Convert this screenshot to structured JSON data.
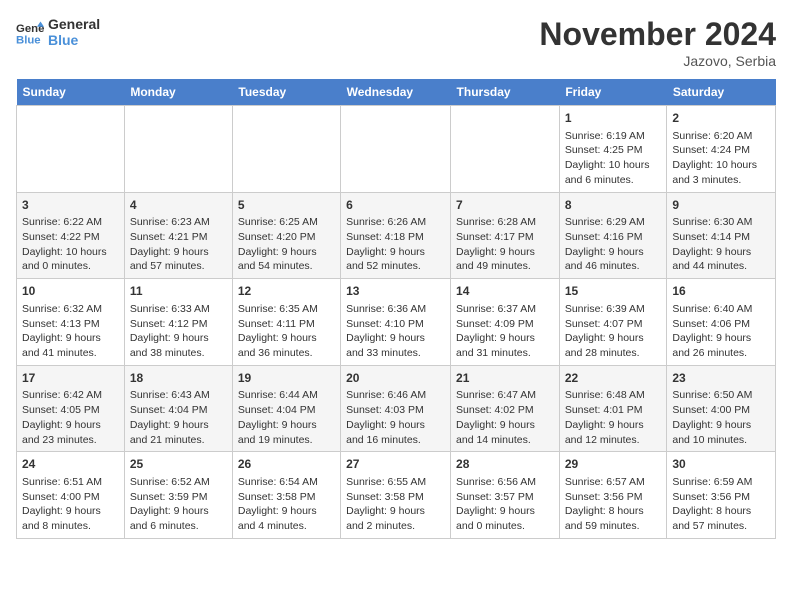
{
  "header": {
    "logo_line1": "General",
    "logo_line2": "Blue",
    "month": "November 2024",
    "location": "Jazovo, Serbia"
  },
  "weekdays": [
    "Sunday",
    "Monday",
    "Tuesday",
    "Wednesday",
    "Thursday",
    "Friday",
    "Saturday"
  ],
  "weeks": [
    [
      {
        "day": "",
        "text": ""
      },
      {
        "day": "",
        "text": ""
      },
      {
        "day": "",
        "text": ""
      },
      {
        "day": "",
        "text": ""
      },
      {
        "day": "",
        "text": ""
      },
      {
        "day": "1",
        "text": "Sunrise: 6:19 AM\nSunset: 4:25 PM\nDaylight: 10 hours and 6 minutes."
      },
      {
        "day": "2",
        "text": "Sunrise: 6:20 AM\nSunset: 4:24 PM\nDaylight: 10 hours and 3 minutes."
      }
    ],
    [
      {
        "day": "3",
        "text": "Sunrise: 6:22 AM\nSunset: 4:22 PM\nDaylight: 10 hours and 0 minutes."
      },
      {
        "day": "4",
        "text": "Sunrise: 6:23 AM\nSunset: 4:21 PM\nDaylight: 9 hours and 57 minutes."
      },
      {
        "day": "5",
        "text": "Sunrise: 6:25 AM\nSunset: 4:20 PM\nDaylight: 9 hours and 54 minutes."
      },
      {
        "day": "6",
        "text": "Sunrise: 6:26 AM\nSunset: 4:18 PM\nDaylight: 9 hours and 52 minutes."
      },
      {
        "day": "7",
        "text": "Sunrise: 6:28 AM\nSunset: 4:17 PM\nDaylight: 9 hours and 49 minutes."
      },
      {
        "day": "8",
        "text": "Sunrise: 6:29 AM\nSunset: 4:16 PM\nDaylight: 9 hours and 46 minutes."
      },
      {
        "day": "9",
        "text": "Sunrise: 6:30 AM\nSunset: 4:14 PM\nDaylight: 9 hours and 44 minutes."
      }
    ],
    [
      {
        "day": "10",
        "text": "Sunrise: 6:32 AM\nSunset: 4:13 PM\nDaylight: 9 hours and 41 minutes."
      },
      {
        "day": "11",
        "text": "Sunrise: 6:33 AM\nSunset: 4:12 PM\nDaylight: 9 hours and 38 minutes."
      },
      {
        "day": "12",
        "text": "Sunrise: 6:35 AM\nSunset: 4:11 PM\nDaylight: 9 hours and 36 minutes."
      },
      {
        "day": "13",
        "text": "Sunrise: 6:36 AM\nSunset: 4:10 PM\nDaylight: 9 hours and 33 minutes."
      },
      {
        "day": "14",
        "text": "Sunrise: 6:37 AM\nSunset: 4:09 PM\nDaylight: 9 hours and 31 minutes."
      },
      {
        "day": "15",
        "text": "Sunrise: 6:39 AM\nSunset: 4:07 PM\nDaylight: 9 hours and 28 minutes."
      },
      {
        "day": "16",
        "text": "Sunrise: 6:40 AM\nSunset: 4:06 PM\nDaylight: 9 hours and 26 minutes."
      }
    ],
    [
      {
        "day": "17",
        "text": "Sunrise: 6:42 AM\nSunset: 4:05 PM\nDaylight: 9 hours and 23 minutes."
      },
      {
        "day": "18",
        "text": "Sunrise: 6:43 AM\nSunset: 4:04 PM\nDaylight: 9 hours and 21 minutes."
      },
      {
        "day": "19",
        "text": "Sunrise: 6:44 AM\nSunset: 4:04 PM\nDaylight: 9 hours and 19 minutes."
      },
      {
        "day": "20",
        "text": "Sunrise: 6:46 AM\nSunset: 4:03 PM\nDaylight: 9 hours and 16 minutes."
      },
      {
        "day": "21",
        "text": "Sunrise: 6:47 AM\nSunset: 4:02 PM\nDaylight: 9 hours and 14 minutes."
      },
      {
        "day": "22",
        "text": "Sunrise: 6:48 AM\nSunset: 4:01 PM\nDaylight: 9 hours and 12 minutes."
      },
      {
        "day": "23",
        "text": "Sunrise: 6:50 AM\nSunset: 4:00 PM\nDaylight: 9 hours and 10 minutes."
      }
    ],
    [
      {
        "day": "24",
        "text": "Sunrise: 6:51 AM\nSunset: 4:00 PM\nDaylight: 9 hours and 8 minutes."
      },
      {
        "day": "25",
        "text": "Sunrise: 6:52 AM\nSunset: 3:59 PM\nDaylight: 9 hours and 6 minutes."
      },
      {
        "day": "26",
        "text": "Sunrise: 6:54 AM\nSunset: 3:58 PM\nDaylight: 9 hours and 4 minutes."
      },
      {
        "day": "27",
        "text": "Sunrise: 6:55 AM\nSunset: 3:58 PM\nDaylight: 9 hours and 2 minutes."
      },
      {
        "day": "28",
        "text": "Sunrise: 6:56 AM\nSunset: 3:57 PM\nDaylight: 9 hours and 0 minutes."
      },
      {
        "day": "29",
        "text": "Sunrise: 6:57 AM\nSunset: 3:56 PM\nDaylight: 8 hours and 59 minutes."
      },
      {
        "day": "30",
        "text": "Sunrise: 6:59 AM\nSunset: 3:56 PM\nDaylight: 8 hours and 57 minutes."
      }
    ]
  ]
}
